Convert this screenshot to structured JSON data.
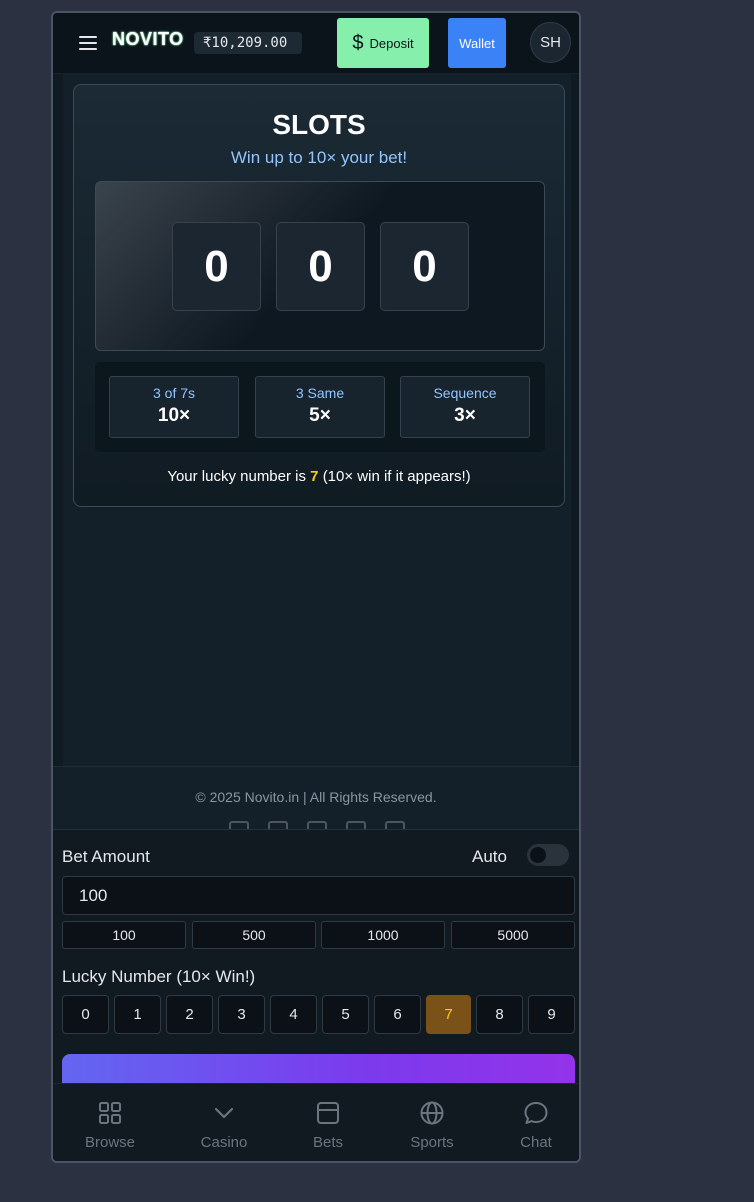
{
  "header": {
    "logo": "NOVITO",
    "balance": "₹10,209.00",
    "deposit_label": "Deposit",
    "deposit_icon": "dollar-sign-icon",
    "wallet_label": "Wallet",
    "avatar_initials": "SH"
  },
  "game": {
    "title": "SLOTS",
    "subtitle": "Win up to 10× your bet!",
    "reels": [
      "0",
      "0",
      "0"
    ],
    "payouts": [
      {
        "label": "3 of 7s",
        "multiplier": "10×"
      },
      {
        "label": "3 Same",
        "multiplier": "5×"
      },
      {
        "label": "Sequence",
        "multiplier": "3×"
      }
    ],
    "lucky_prefix": "Your lucky number is",
    "lucky_number": "7",
    "lucky_suffix": "(10× win if it appears!)"
  },
  "footer": {
    "copyright": "© 2025 Novito.in | All Rights Reserved.",
    "social_icons": [
      "twitter-icon",
      "instagram-icon",
      "facebook-icon",
      "youtube-icon",
      "twitch-icon"
    ]
  },
  "controls": {
    "bet_label": "Bet Amount",
    "auto_label": "Auto",
    "auto_enabled": false,
    "bet_value": "100",
    "quick_bets": [
      "100",
      "500",
      "1000",
      "5000"
    ],
    "lucky_label": "Lucky Number (10× Win!)",
    "numbers": [
      "0",
      "1",
      "2",
      "3",
      "4",
      "5",
      "6",
      "7",
      "8",
      "9"
    ],
    "selected_number": "7"
  },
  "nav": [
    {
      "label": "Browse",
      "icon": "grid-icon"
    },
    {
      "label": "Casino",
      "icon": "chevron-down-icon"
    },
    {
      "label": "Bets",
      "icon": "ticket-icon"
    },
    {
      "label": "Sports",
      "icon": "globe-icon"
    },
    {
      "label": "Chat",
      "icon": "chat-bubble-icon"
    }
  ],
  "colors": {
    "page_bg": "#2c3142",
    "deposit": "#86efac",
    "wallet": "#3b82f6",
    "accent_blue": "#93c5fd",
    "lucky_yellow": "#facc15",
    "spin_gradient_start": "#6366f1",
    "spin_gradient_end": "#9333ea"
  }
}
